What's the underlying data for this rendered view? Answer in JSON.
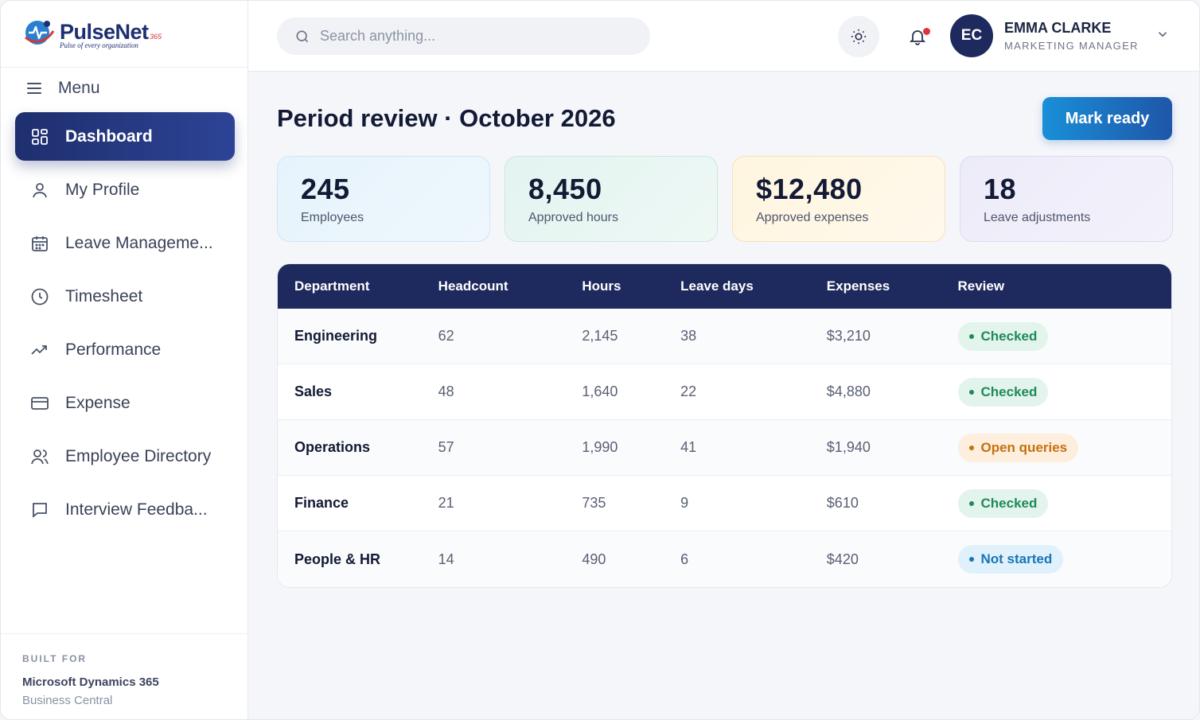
{
  "brand": {
    "name": "PulseNet",
    "superscript": "365",
    "tagline": "Pulse of every organization"
  },
  "sidebar": {
    "menu_label": "Menu",
    "items": [
      {
        "label": "Dashboard",
        "icon": "grid-icon",
        "active": true
      },
      {
        "label": "My Profile",
        "icon": "user-icon",
        "active": false
      },
      {
        "label": "Leave Manageme...",
        "icon": "calendar-icon",
        "active": false
      },
      {
        "label": "Timesheet",
        "icon": "clock-icon",
        "active": false
      },
      {
        "label": "Performance",
        "icon": "trend-up-icon",
        "active": false
      },
      {
        "label": "Expense",
        "icon": "credit-card-icon",
        "active": false
      },
      {
        "label": "Employee Directory",
        "icon": "users-icon",
        "active": false
      },
      {
        "label": "Interview Feedba...",
        "icon": "chat-icon",
        "active": false
      }
    ],
    "footer": {
      "kicker": "BUILT FOR",
      "product": "Microsoft Dynamics 365",
      "edition": "Business Central"
    }
  },
  "header": {
    "search_placeholder": "Search anything...",
    "user": {
      "initials": "EC",
      "name": "EMMA CLARKE",
      "role": "MARKETING MANAGER"
    }
  },
  "main": {
    "title": "Period review · October 2026",
    "action_label": "Mark ready",
    "stats": [
      {
        "value": "245",
        "label": "Employees"
      },
      {
        "value": "8,450",
        "label": "Approved hours"
      },
      {
        "value": "$12,480",
        "label": "Approved expenses"
      },
      {
        "value": "18",
        "label": "Leave adjustments"
      }
    ],
    "table": {
      "headers": [
        "Department",
        "Headcount",
        "Hours",
        "Leave days",
        "Expenses",
        "Review"
      ],
      "rows": [
        {
          "department": "Engineering",
          "headcount": "62",
          "hours": "2,145",
          "leave_days": "38",
          "expenses": "$3,210",
          "review": "Checked",
          "status": "green"
        },
        {
          "department": "Sales",
          "headcount": "48",
          "hours": "1,640",
          "leave_days": "22",
          "expenses": "$4,880",
          "review": "Checked",
          "status": "green"
        },
        {
          "department": "Operations",
          "headcount": "57",
          "hours": "1,990",
          "leave_days": "41",
          "expenses": "$1,940",
          "review": "Open queries",
          "status": "orange"
        },
        {
          "department": "Finance",
          "headcount": "21",
          "hours": "735",
          "leave_days": "9",
          "expenses": "$610",
          "review": "Checked",
          "status": "green"
        },
        {
          "department": "People & HR",
          "headcount": "14",
          "hours": "490",
          "leave_days": "6",
          "expenses": "$420",
          "review": "Not started",
          "status": "blue"
        }
      ]
    }
  },
  "colors": {
    "primary_navy": "#1e2a5e",
    "accent_blue": "#1a8fd8",
    "status_green": "#1f8a5b",
    "status_orange": "#c6700e",
    "status_blue": "#1776b5"
  }
}
